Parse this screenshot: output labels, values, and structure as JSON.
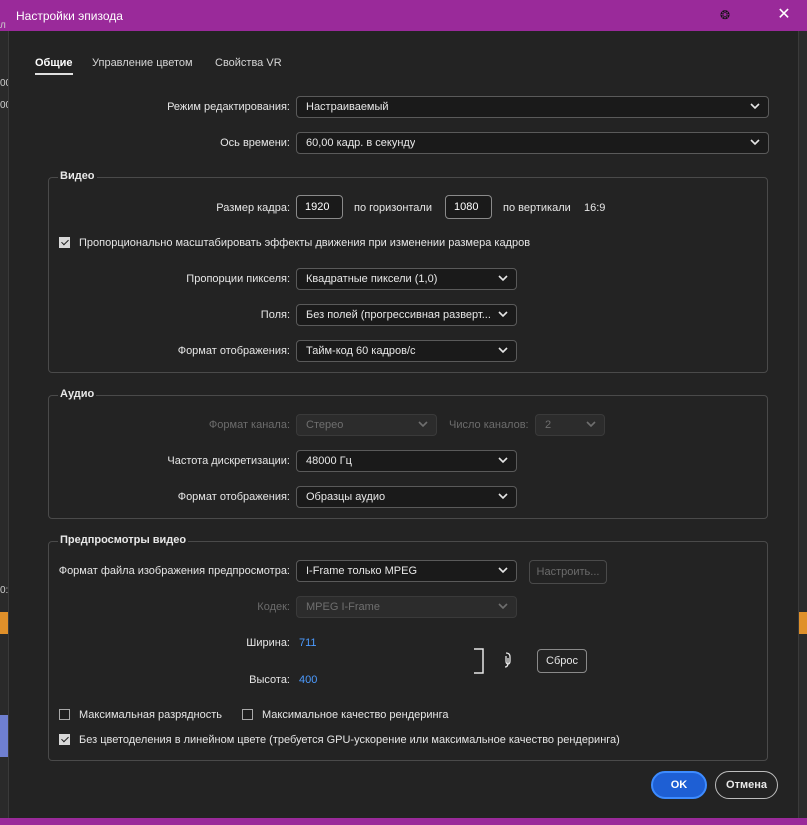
{
  "window": {
    "title": "Настройки эпизода"
  },
  "tabs": [
    {
      "label": "Общие",
      "active": true
    },
    {
      "label": "Управление цветом",
      "active": false
    },
    {
      "label": "Свойства VR",
      "active": false
    }
  ],
  "general": {
    "edit_mode_label": "Режим редактирования:",
    "edit_mode_value": "Настраиваемый",
    "timebase_label": "Ось времени:",
    "timebase_value": "60,00  кадр. в секунду"
  },
  "video": {
    "title": "Видео",
    "frame_size_label": "Размер кадра:",
    "frame_width": "1920",
    "horizontal_label": "по горизонтали",
    "frame_height": "1080",
    "vertical_label": "по вертикали",
    "aspect": "16:9",
    "scale_effects_label": "Пропорционально масштабировать эффекты движения при изменении размера кадров",
    "scale_effects_checked": true,
    "pixel_aspect_label": "Пропорции пикселя:",
    "pixel_aspect_value": "Квадратные пиксели (1,0)",
    "fields_label": "Поля:",
    "fields_value": "Без полей (прогрессивная разверт...",
    "display_format_label": "Формат отображения:",
    "display_format_value": "Тайм-код 60 кадров/с"
  },
  "audio": {
    "title": "Аудио",
    "channel_format_label": "Формат канала:",
    "channel_format_value": "Стерео",
    "channels_label": "Число каналов:",
    "channels_value": "2",
    "sample_rate_label": "Частота дискретизации:",
    "sample_rate_value": "48000 Гц",
    "display_format_label": "Формат отображения:",
    "display_format_value": "Образцы аудио"
  },
  "previews": {
    "title": "Предпросмотры видео",
    "file_format_label": "Формат файла изображения предпросмотра:",
    "file_format_value": "I-Frame только MPEG",
    "configure_button": "Настроить...",
    "codec_label": "Кодек:",
    "codec_value": "MPEG I-Frame",
    "width_label": "Ширина:",
    "width_value": "711",
    "height_label": "Высота:",
    "height_value": "400",
    "reset_button": "Сброс",
    "max_bit_depth_label": "Максимальная разрядность",
    "max_bit_depth_checked": false,
    "max_render_quality_label": "Максимальное качество рендеринга",
    "max_render_quality_checked": false,
    "linear_color_label": "Без цветоделения в линейном цвете (требуется GPU-ускорение или максимальное качество рендеринга)",
    "linear_color_checked": true
  },
  "footer": {
    "ok_label": "OK",
    "cancel_label": "Отмена"
  },
  "background_fragments": {
    "a": "л",
    "b": "00",
    "c": "00",
    "d": "0:"
  },
  "colors": {
    "titlebar": "#9a2a9a",
    "accent": "#1e5fd4",
    "link": "#4c9bff"
  },
  "icons": {
    "close": "close-icon",
    "pin": "pin-icon",
    "link": "link-chain-icon",
    "dropdown": "chevron-down-icon"
  }
}
